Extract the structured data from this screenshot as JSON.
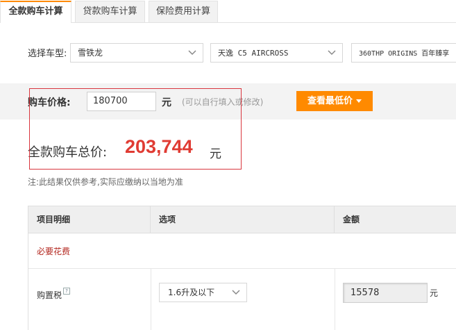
{
  "tabs": [
    {
      "label": "全款购车计算",
      "active": true
    },
    {
      "label": "贷款购车计算",
      "active": false
    },
    {
      "label": "保险费用计算",
      "active": false
    }
  ],
  "selector": {
    "label": "选择车型:",
    "brand": "雪铁龙",
    "model": "天逸 C5 AIRCROSS",
    "trim": "360THP ORIGINS 百年臻享"
  },
  "price": {
    "label": "购车价格:",
    "value": "180700",
    "unit": "元",
    "hint": "(可以自行填入或修改)",
    "quote_button": "查看最低价"
  },
  "total": {
    "label": "全款购车总价:",
    "value": "203,744",
    "unit": "元"
  },
  "note": "注:此结果仅供参考,实际应缴纳以当地为准",
  "table": {
    "headers": [
      "项目明细",
      "选项",
      "金额"
    ],
    "section_title": "必要花费",
    "rows": [
      {
        "label": "购置税",
        "option": "1.6升及以下",
        "amount": "15578",
        "unit": "元"
      }
    ]
  },
  "colors": {
    "accent": "#ff8a00",
    "total_red": "#e03b33",
    "section_red": "#b3261e",
    "highlight_border": "#d9363e"
  }
}
